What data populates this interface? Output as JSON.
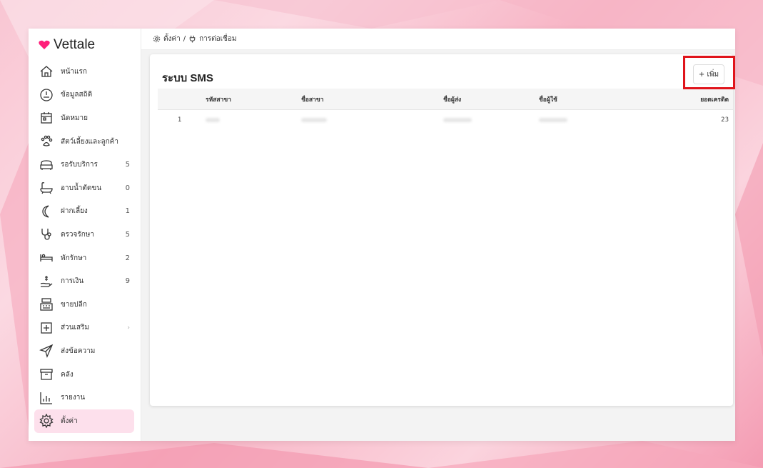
{
  "app": {
    "name": "Vettale",
    "brand_color": "#ff1f7a"
  },
  "breadcrumb": {
    "settings": "ตั้งค่า",
    "separator": "/",
    "connections": "การต่อเชื่อม"
  },
  "sidebar": {
    "items": [
      {
        "label": "หน้าแรก",
        "icon": "home-icon",
        "count": ""
      },
      {
        "label": "ข้อมูลสถิติ",
        "icon": "gauge-icon",
        "count": ""
      },
      {
        "label": "นัดหมาย",
        "icon": "calendar-icon",
        "count": ""
      },
      {
        "label": "สัตว์เลี้ยงและลูกค้า",
        "icon": "paw-icon",
        "count": ""
      },
      {
        "label": "รอรับบริการ",
        "icon": "sofa-icon",
        "count": "5"
      },
      {
        "label": "อาบน้ำตัดขน",
        "icon": "bathtub-icon",
        "count": "0"
      },
      {
        "label": "ฝากเลี้ยง",
        "icon": "moon-icon",
        "count": "1"
      },
      {
        "label": "ตรวจรักษา",
        "icon": "stethoscope-icon",
        "count": "5"
      },
      {
        "label": "พักรักษา",
        "icon": "bed-icon",
        "count": "2"
      },
      {
        "label": "การเงิน",
        "icon": "money-hand-icon",
        "count": "9"
      },
      {
        "label": "ขายปลีก",
        "icon": "cash-register-icon",
        "count": ""
      },
      {
        "label": "ส่วนเสริม",
        "icon": "plus-square-icon",
        "count": "",
        "chevron": "›"
      },
      {
        "label": "ส่งข้อความ",
        "icon": "send-icon",
        "count": ""
      },
      {
        "label": "คลัง",
        "icon": "archive-icon",
        "count": ""
      },
      {
        "label": "รายงาน",
        "icon": "bar-chart-icon",
        "count": ""
      },
      {
        "label": "ตั้งค่า",
        "icon": "gear-icon",
        "count": "",
        "active": true
      }
    ]
  },
  "main": {
    "title": "ระบบ SMS",
    "add_button": "+ เพิ่ม",
    "table": {
      "columns": [
        "รหัสสาขา",
        "ชื่อสาขา",
        "ชื่อผู้ส่ง",
        "ชื่อผู้ใช้",
        "ยอดเครดิต"
      ],
      "rows": [
        {
          "index": "1",
          "credit": "23"
        }
      ]
    }
  }
}
